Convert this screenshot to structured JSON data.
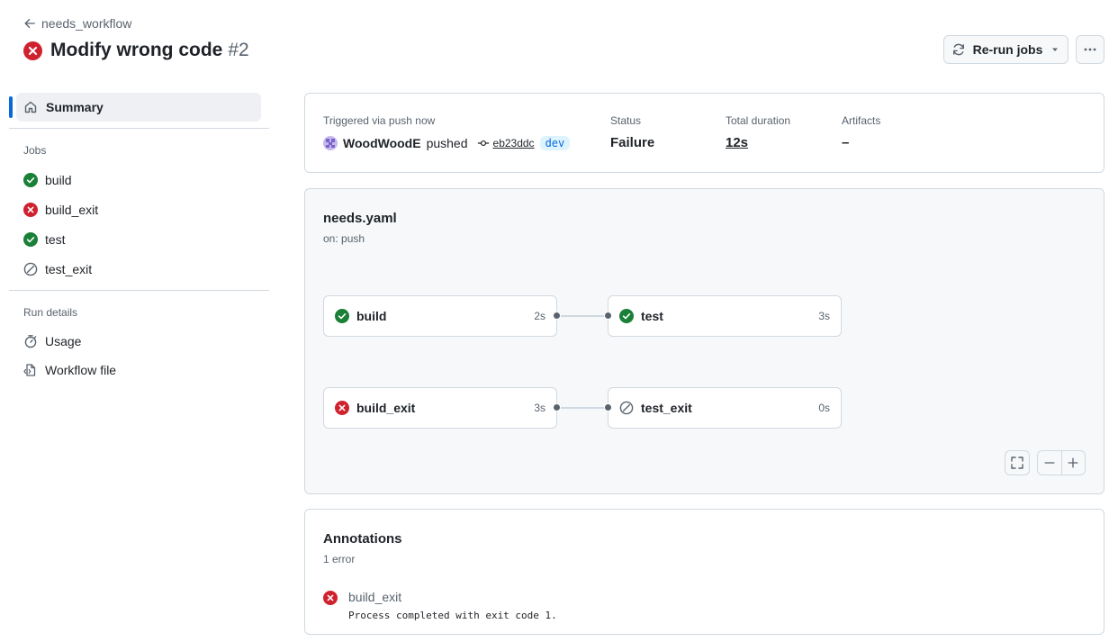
{
  "header": {
    "back_label": "needs_workflow",
    "title": "Modify wrong code",
    "run_number": "#2",
    "rerun_label": "Re-run jobs"
  },
  "sidebar": {
    "summary_label": "Summary",
    "jobs_heading": "Jobs",
    "jobs": [
      {
        "name": "build",
        "status": "success"
      },
      {
        "name": "build_exit",
        "status": "failure"
      },
      {
        "name": "test",
        "status": "success"
      },
      {
        "name": "test_exit",
        "status": "skipped"
      }
    ],
    "run_details_heading": "Run details",
    "usage_label": "Usage",
    "workflow_file_label": "Workflow file"
  },
  "summary_card": {
    "trigger_label": "Triggered via push now",
    "actor": "WoodWoodE",
    "action": "pushed",
    "commit": "eb23ddc",
    "branch": "dev",
    "status_label": "Status",
    "status_value": "Failure",
    "duration_label": "Total duration",
    "duration_value": "12s",
    "artifacts_label": "Artifacts",
    "artifacts_value": "–"
  },
  "graph": {
    "file": "needs.yaml",
    "trigger": "on: push",
    "nodes": [
      {
        "name": "build",
        "duration": "2s",
        "status": "success"
      },
      {
        "name": "test",
        "duration": "3s",
        "status": "success"
      },
      {
        "name": "build_exit",
        "duration": "3s",
        "status": "failure"
      },
      {
        "name": "test_exit",
        "duration": "0s",
        "status": "skipped"
      }
    ]
  },
  "annotations": {
    "title": "Annotations",
    "count": "1 error",
    "items": [
      {
        "job": "build_exit",
        "message": "Process completed with exit code 1."
      }
    ]
  },
  "colors": {
    "success": "#1a7f37",
    "failure": "#cf222e",
    "accent": "#0969da",
    "muted": "#59636e",
    "border": "#d1d9e0"
  }
}
